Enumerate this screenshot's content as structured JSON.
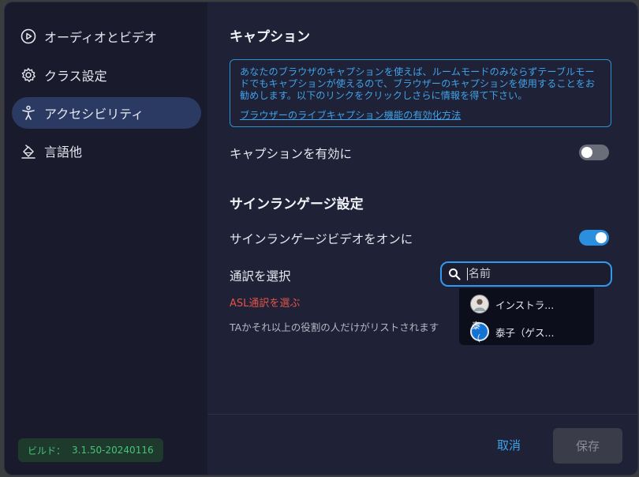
{
  "sidebar": {
    "items": [
      {
        "label": "オーディオとビデオ",
        "icon": "play-circle-icon"
      },
      {
        "label": "クラス設定",
        "icon": "gear-icon"
      },
      {
        "label": "アクセシビリティ",
        "icon": "accessibility-icon",
        "active": true
      },
      {
        "label": "言語他",
        "icon": "language-icon"
      }
    ],
    "build_label": "ビルド：",
    "build_version": "3.1.50-20240116"
  },
  "caption": {
    "heading": "キャプション",
    "info_text": "あなたのブラウザのキャプションを使えば、ルームモードのみならずテーブルモードでもキャプションが使えるので、ブラウザーのキャプションを使用することをお勧めします。以下のリンクをクリックしさらに情報を得て下さい。",
    "info_link": "ブラウザーのライブキャプション機能の有効化方法",
    "enable_label": "キャプションを有効に",
    "enable_on": false
  },
  "sign_language": {
    "heading": "サインランゲージ設定",
    "video_label": "サインランゲージビデオをオンに",
    "video_on": true,
    "interpreter_label": "通訳を選択",
    "search_placeholder": "名前",
    "asl_link": "ASL通訳を選ぶ",
    "hint": "TAかそれ以上の役割の人だけがリストされます",
    "options": [
      {
        "name": "インストラ..."
      },
      {
        "name": "泰子（ゲス...",
        "avatar_text": "泰（"
      }
    ]
  },
  "footer": {
    "cancel_label": "取消",
    "save_label": "保存"
  },
  "colors": {
    "accent": "#2e9af0",
    "toggle_on": "#2b8fe0",
    "link_red": "#e0544a",
    "build_green": "#47c27a"
  }
}
